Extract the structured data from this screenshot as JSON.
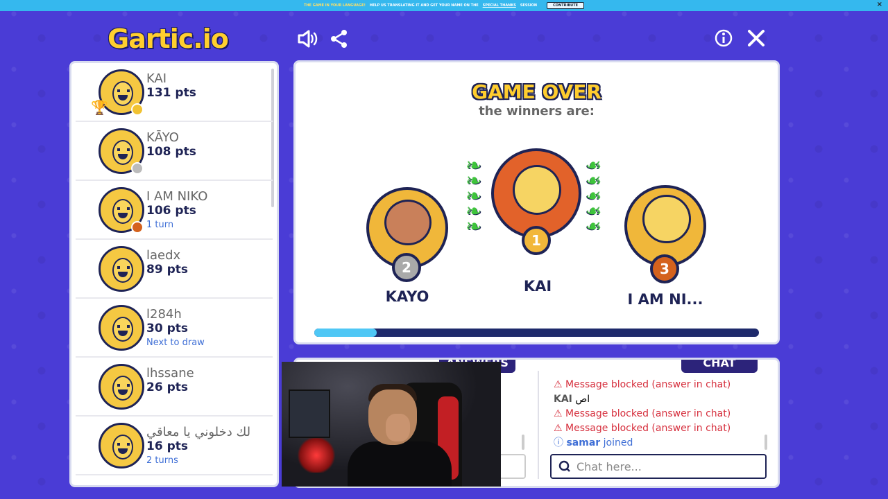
{
  "banner": {
    "lead": "THE GAME IN YOUR LANGUAGE!",
    "text": "HELP US TRANSLATING IT AND GET YOUR NAME ON THE",
    "link": "SPECIAL THANKS",
    "tail": "SESSION",
    "button": "CONTRIBUTE",
    "close": "×"
  },
  "logo": {
    "main": "Gartic",
    "suffix": ".io"
  },
  "header": {
    "sound_icon": "speaker-icon",
    "share_icon": "share-icon",
    "info_icon": "info-icon",
    "close_icon": "close-icon"
  },
  "players": [
    {
      "name": "KAI",
      "points": "131 pts",
      "extra": "",
      "dot": "#f1c232",
      "trophy": true
    },
    {
      "name": "KĀYO",
      "points": "108 pts",
      "extra": "",
      "dot": "#bbbbbb",
      "trophy": false
    },
    {
      "name": "I AM NIKO",
      "points": "106 pts",
      "extra": "1 turn",
      "dot": "#d4621d",
      "trophy": false
    },
    {
      "name": "laedx",
      "points": "89 pts",
      "extra": "",
      "dot": "",
      "trophy": false
    },
    {
      "name": "l284h",
      "points": "30 pts",
      "extra": "Next to draw",
      "dot": "",
      "trophy": false
    },
    {
      "name": "lhssane",
      "points": "26 pts",
      "extra": "",
      "dot": "",
      "trophy": false
    },
    {
      "name": "لك دخلوني يا معاقي",
      "points": "16 pts",
      "extra": "2 turns",
      "dot": "",
      "trophy": false
    }
  ],
  "game": {
    "title": "GAME OVER",
    "subtitle": "the winners are:",
    "first": {
      "name": "KAI",
      "rank": "1"
    },
    "second": {
      "name": "KAYO",
      "rank": "2"
    },
    "third": {
      "name": "I AM NI...",
      "rank": "3"
    },
    "progress": 0.14,
    "colors": {
      "gold": "#f2b73a",
      "silver": "#a9a9a9",
      "bronze": "#d4621d"
    }
  },
  "tabs": {
    "answers": "ANSWERS",
    "chat": "CHAT"
  },
  "chat": {
    "messages": [
      {
        "type": "blocked",
        "text": "Message blocked (answer in chat)"
      },
      {
        "type": "user",
        "name": "KAI",
        "text": "اص"
      },
      {
        "type": "blocked",
        "text": "Message blocked (answer in chat)"
      },
      {
        "type": "blocked",
        "text": "Message blocked (answer in chat)"
      },
      {
        "type": "system",
        "name": "samar",
        "text": "joined"
      }
    ],
    "placeholder": "Chat here..."
  }
}
